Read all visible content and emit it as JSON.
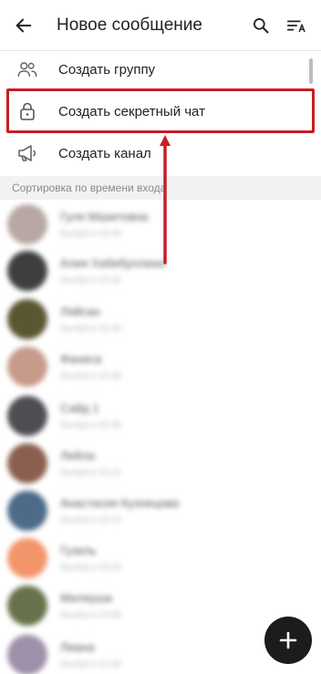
{
  "appbar": {
    "title": "Новое сообщение",
    "back_icon": "arrow-left-icon",
    "search_icon": "search-icon",
    "sort_icon": "sort-alpha-icon"
  },
  "menu": {
    "items": [
      {
        "label": "Создать группу",
        "icon": "people-icon"
      },
      {
        "label": "Создать секретный чат",
        "icon": "lock-icon"
      },
      {
        "label": "Создать канал",
        "icon": "megaphone-icon"
      }
    ]
  },
  "section": {
    "header": "Сортировка по времени входа"
  },
  "contacts": [
    {
      "name": "Гуля Мазитовна",
      "status": "был(а) в 15:45",
      "color": "#b8a7a2"
    },
    {
      "name": "Алия Хабибуллина",
      "status": "был(а) в 15:42",
      "color": "#3d3f3e"
    },
    {
      "name": "Ляйсан",
      "status": "был(а) в 15:40",
      "color": "#5a5631"
    },
    {
      "name": "Фаниса",
      "status": "был(а) в 15:38",
      "color": "#c89a8a"
    },
    {
      "name": "Сайд 1",
      "status": "был(а) в 15:30",
      "color": "#4d4d52"
    },
    {
      "name": "Лейла",
      "status": "был(а) в 15:21",
      "color": "#8a5f4f"
    },
    {
      "name": "Анастасия Кузнецова",
      "status": "был(а) в 15:10",
      "color": "#4d6a88"
    },
    {
      "name": "Гузель",
      "status": "был(а) в 15:02",
      "color": "#f2956a"
    },
    {
      "name": "Миляуша",
      "status": "был(а) в 14:58",
      "color": "#68724a"
    },
    {
      "name": "Лиана",
      "status": "был(а) в 14:40",
      "color": "#9e90a8"
    }
  ],
  "fab": {
    "icon": "plus-icon"
  },
  "colors": {
    "highlight": "#c91d25",
    "fab": "#1c1c1c"
  }
}
